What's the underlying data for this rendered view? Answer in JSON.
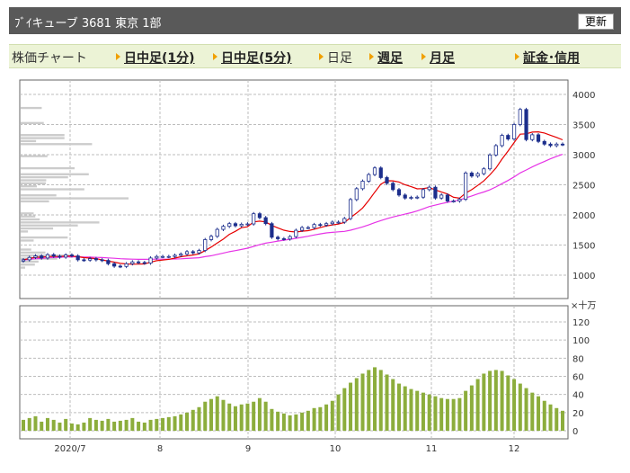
{
  "header": {
    "title": "ﾌﾞｲキューブ 3681 東京 1部",
    "refresh_label": "更新"
  },
  "nav": {
    "label": "株価チャート",
    "items": [
      {
        "label": "日中足(1分)",
        "link": true
      },
      {
        "label": "日中足(5分)",
        "link": true
      },
      {
        "label": "日足",
        "link": false
      },
      {
        "label": "週足",
        "link": true
      },
      {
        "label": "月足",
        "link": true
      }
    ],
    "credit_label": "証金･信用"
  },
  "colors": {
    "up_candle": "#ffffff",
    "down_candle": "#1c2e8c",
    "ma_short": "#e60000",
    "ma_long": "#e633e6",
    "volume": "#8cad3c",
    "volume_profile": "#cccccc",
    "header_bg": "#595959",
    "nav_bg": "#ecf3d6"
  },
  "chart_data": [
    {
      "type": "candlestick",
      "title": "",
      "x_labels": [
        "2020/7",
        "8",
        "9",
        "10",
        "11",
        "12"
      ],
      "y_ticks": [
        1000,
        1500,
        2000,
        2500,
        3000,
        3500,
        4000
      ],
      "ylim": [
        760,
        4060
      ],
      "grid": true,
      "series": [
        {
          "name": "",
          "kind": "close",
          "values": [
            1255,
            1295,
            1320,
            1285,
            1340,
            1315,
            1300,
            1335,
            1320,
            1255,
            1250,
            1275,
            1255,
            1245,
            1190,
            1150,
            1145,
            1190,
            1220,
            1210,
            1200,
            1285,
            1310,
            1310,
            1310,
            1330,
            1350,
            1390,
            1370,
            1410,
            1590,
            1645,
            1760,
            1810,
            1855,
            1820,
            1845,
            1850,
            2020,
            1955,
            1855,
            1630,
            1605,
            1600,
            1640,
            1745,
            1790,
            1790,
            1840,
            1830,
            1855,
            1880,
            1880,
            1940,
            2255,
            2435,
            2560,
            2670,
            2780,
            2620,
            2525,
            2420,
            2330,
            2280,
            2290,
            2295,
            2420,
            2460,
            2280,
            2330,
            2230,
            2230,
            2260,
            2695,
            2645,
            2685,
            2765,
            2995,
            3150,
            3320,
            3260,
            3500,
            3750,
            3250,
            3330,
            3220,
            3175,
            3150,
            3175,
            3170
          ]
        },
        {
          "name": "",
          "kind": "ma_short",
          "values": [
            1253,
            1278,
            1299,
            1299,
            1309,
            1311,
            1311,
            1315,
            1318,
            1306,
            1291,
            1284,
            1274,
            1254,
            1233,
            1216,
            1196,
            1187,
            1182,
            1183,
            1187,
            1215,
            1241,
            1251,
            1263,
            1283,
            1306,
            1321,
            1334,
            1353,
            1408,
            1467,
            1533,
            1598,
            1678,
            1729,
            1788,
            1803,
            1884,
            1897,
            1884,
            1825,
            1785,
            1747,
            1726,
            1716,
            1730,
            1739,
            1763,
            1789,
            1817,
            1835,
            1848,
            1876,
            1955,
            2032,
            2115,
            2240,
            2377,
            2510,
            2567,
            2565,
            2547,
            2500,
            2469,
            2433,
            2437,
            2454,
            2415,
            2379,
            2348,
            2293,
            2278,
            2362,
            2419,
            2490,
            2566,
            2665,
            2777,
            2927,
            3060,
            3201,
            3340,
            3347,
            3374,
            3379,
            3360,
            3323,
            3286,
            3247
          ]
        },
        {
          "name": "",
          "kind": "ma_long",
          "values": [
            1250,
            1262,
            1273,
            1278,
            1288,
            1294,
            1297,
            1303,
            1306,
            1305,
            1302,
            1300,
            1296,
            1293,
            1287,
            1280,
            1273,
            1269,
            1265,
            1263,
            1262,
            1264,
            1266,
            1266,
            1266,
            1269,
            1272,
            1278,
            1283,
            1290,
            1307,
            1323,
            1345,
            1367,
            1389,
            1407,
            1427,
            1448,
            1478,
            1506,
            1531,
            1548,
            1565,
            1580,
            1596,
            1612,
            1628,
            1646,
            1667,
            1685,
            1701,
            1711,
            1719,
            1727,
            1747,
            1773,
            1801,
            1835,
            1872,
            1906,
            1938,
            1965,
            1990,
            2013,
            2037,
            2066,
            2101,
            2139,
            2163,
            2188,
            2209,
            2228,
            2247,
            2282,
            2315,
            2350,
            2380,
            2417,
            2464,
            2520,
            2572,
            2632,
            2697,
            2746,
            2797,
            2845,
            2887,
            2931,
            2972,
            3006
          ]
        }
      ]
    },
    {
      "type": "bar",
      "title": "",
      "unit_label": "×十万",
      "x_labels": [
        "2020/7",
        "8",
        "9",
        "10",
        "11",
        "12"
      ],
      "y_ticks": [
        0,
        20,
        40,
        60,
        80,
        100,
        120
      ],
      "ylim": [
        0,
        133
      ],
      "grid": true,
      "series": [
        {
          "name": "",
          "kind": "volume",
          "values": [
            12,
            14,
            16,
            10,
            14,
            12,
            9,
            13,
            8,
            7,
            9,
            14,
            12,
            11,
            13,
            10,
            11,
            12,
            14,
            10,
            9,
            12,
            13,
            14,
            15,
            16,
            18,
            20,
            23,
            26,
            32,
            35,
            38,
            34,
            30,
            27,
            29,
            30,
            32,
            36,
            32,
            24,
            21,
            19,
            17,
            18,
            20,
            22,
            25,
            26,
            29,
            33,
            40,
            47,
            53,
            58,
            63,
            67,
            70,
            67,
            62,
            57,
            52,
            49,
            46,
            44,
            42,
            40,
            38,
            36,
            35,
            35,
            36,
            44,
            50,
            57,
            63,
            66,
            67,
            66,
            61,
            57,
            52,
            47,
            42,
            38,
            33,
            29,
            25,
            22
          ]
        }
      ]
    }
  ]
}
